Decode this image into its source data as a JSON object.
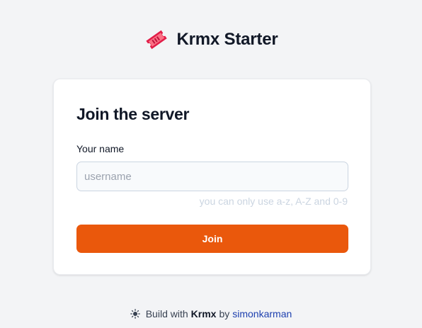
{
  "brand": {
    "title": "Krmx Starter",
    "icon": "ticket-icon",
    "icon_color": "#e11d48"
  },
  "card": {
    "title": "Join the server",
    "field_label": "Your name",
    "input_value": "",
    "input_placeholder": "username",
    "hint": "you can only use a-z, A-Z and 0-9",
    "button_label": "Join",
    "button_color": "#ea580c"
  },
  "footer": {
    "icon": "sun-icon",
    "prefix": "Build with",
    "product": "Krmx",
    "by": "by",
    "author": "simonkarman",
    "link_color": "#1e40af"
  }
}
